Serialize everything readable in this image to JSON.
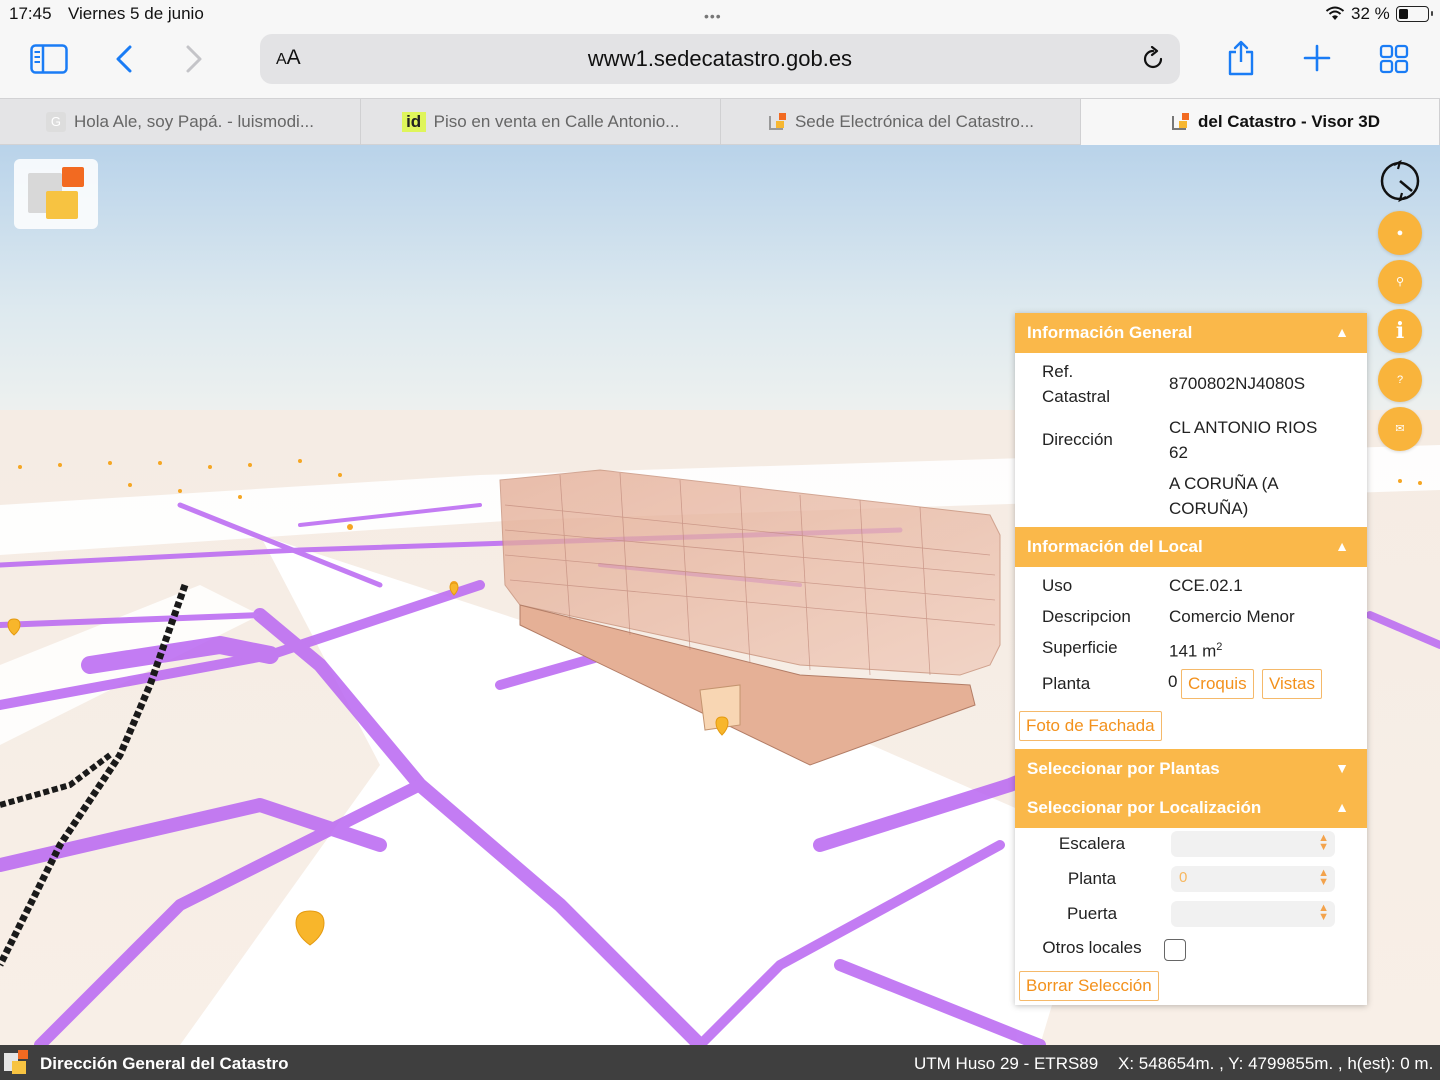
{
  "status": {
    "time": "17:45",
    "date": "Viernes 5 de junio",
    "battery": "32 %",
    "dots": "•••"
  },
  "browser": {
    "aa_small": "A",
    "aa_large": "A",
    "url": "www1.sedecatastro.gob.es",
    "tabs": [
      {
        "label": "Hola Ale, soy Papá. - luismodi...",
        "favicon": "G"
      },
      {
        "label": "Piso en venta en Calle Antonio...",
        "favicon": "id"
      },
      {
        "label": "Sede Electrónica del Catastro...",
        "favicon": "catastro"
      },
      {
        "label": "del Catastro - Visor 3D",
        "favicon": "catastro"
      }
    ],
    "close_glyph": "✕"
  },
  "map": {
    "buttons": [
      {
        "name": "layers",
        "glyph": "●"
      },
      {
        "name": "search",
        "glyph": "⚲"
      },
      {
        "name": "info",
        "glyph": "i"
      },
      {
        "name": "help",
        "glyph": "?"
      },
      {
        "name": "mail",
        "glyph": "✉"
      }
    ]
  },
  "panel": {
    "general": {
      "header": "Información General",
      "arrow": "▲",
      "ref_label_1": "Ref.",
      "ref_label_2": "Catastral",
      "ref_value": "8700802NJ4080S",
      "address_label": "Dirección",
      "address_line1": "CL ANTONIO RIOS",
      "address_line2": "62",
      "address_line3": "A CORUÑA (A",
      "address_line4": "CORUÑA)"
    },
    "local": {
      "header": "Información del Local",
      "arrow": "▲",
      "uso_label": "Uso",
      "uso_value": "CCE.02.1",
      "desc_label": "Descripcion",
      "desc_value": "Comercio Menor",
      "sup_label": "Superficie",
      "sup_value": "141 m",
      "sup_unit_exp": "2",
      "planta_label": "Planta",
      "planta_value": "0",
      "croquis": "Croquis",
      "vistas": "Vistas",
      "foto": "Foto de Fachada"
    },
    "plantas": {
      "header": "Seleccionar por Plantas",
      "arrow": "▼"
    },
    "localizacion": {
      "header": "Seleccionar por Localización",
      "arrow": "▲",
      "escalera_label": "Escalera",
      "escalera_value": "",
      "planta_label": "Planta",
      "planta_value": "0",
      "puerta_label": "Puerta",
      "puerta_value": "",
      "otros_label": "Otros locales",
      "otros_checked": false,
      "borrar": "Borrar Selección"
    }
  },
  "footer": {
    "title": "Dirección General del Catastro",
    "projection": "UTM Huso 29 - ETRS89",
    "coords": "X: 548654m. , Y: 4799855m. , h(est): 0 m."
  },
  "colors": {
    "accent": "#fab84a",
    "accent_text": "#f3911c",
    "ios_blue": "#1a7cf5",
    "street": "#b966f2",
    "building": "#e8b9a7",
    "footer_bg": "#3f3f3f"
  }
}
